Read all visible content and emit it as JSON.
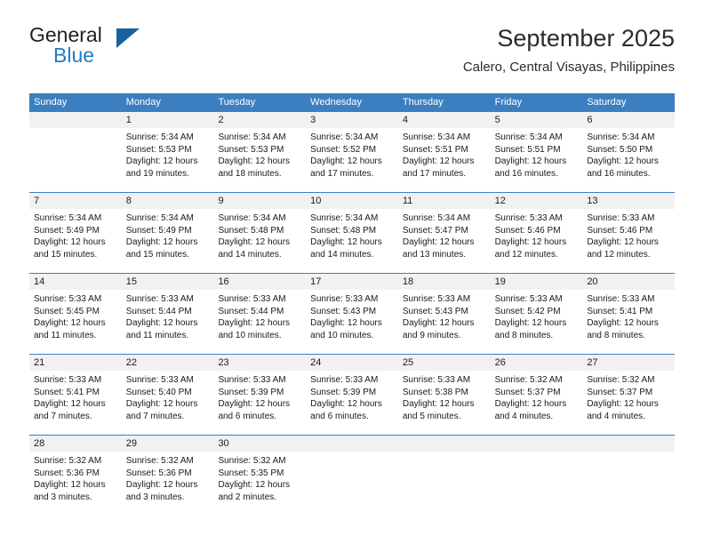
{
  "brand": {
    "name_part1": "General",
    "name_part2": "Blue",
    "triangle_icon": "triangle-icon",
    "color_dark": "#231f20",
    "color_blue": "#1f7dc4",
    "color_triangle": "#18619e"
  },
  "header": {
    "title": "September 2025",
    "subtitle": "Calero, Central Visayas, Philippines"
  },
  "theme": {
    "header_blue": "#3c7fc1",
    "day_band_gray": "#f1f1f1",
    "text": "#1a1a1a"
  },
  "weekdays": [
    "Sunday",
    "Monday",
    "Tuesday",
    "Wednesday",
    "Thursday",
    "Friday",
    "Saturday"
  ],
  "weeks": [
    [
      {
        "day": "",
        "sunrise": "",
        "sunset": "",
        "daylight_line1": "",
        "daylight_line2": "",
        "empty": true
      },
      {
        "day": "1",
        "sunrise": "Sunrise: 5:34 AM",
        "sunset": "Sunset: 5:53 PM",
        "daylight_line1": "Daylight: 12 hours",
        "daylight_line2": "and 19 minutes."
      },
      {
        "day": "2",
        "sunrise": "Sunrise: 5:34 AM",
        "sunset": "Sunset: 5:53 PM",
        "daylight_line1": "Daylight: 12 hours",
        "daylight_line2": "and 18 minutes."
      },
      {
        "day": "3",
        "sunrise": "Sunrise: 5:34 AM",
        "sunset": "Sunset: 5:52 PM",
        "daylight_line1": "Daylight: 12 hours",
        "daylight_line2": "and 17 minutes."
      },
      {
        "day": "4",
        "sunrise": "Sunrise: 5:34 AM",
        "sunset": "Sunset: 5:51 PM",
        "daylight_line1": "Daylight: 12 hours",
        "daylight_line2": "and 17 minutes."
      },
      {
        "day": "5",
        "sunrise": "Sunrise: 5:34 AM",
        "sunset": "Sunset: 5:51 PM",
        "daylight_line1": "Daylight: 12 hours",
        "daylight_line2": "and 16 minutes."
      },
      {
        "day": "6",
        "sunrise": "Sunrise: 5:34 AM",
        "sunset": "Sunset: 5:50 PM",
        "daylight_line1": "Daylight: 12 hours",
        "daylight_line2": "and 16 minutes."
      }
    ],
    [
      {
        "day": "7",
        "sunrise": "Sunrise: 5:34 AM",
        "sunset": "Sunset: 5:49 PM",
        "daylight_line1": "Daylight: 12 hours",
        "daylight_line2": "and 15 minutes."
      },
      {
        "day": "8",
        "sunrise": "Sunrise: 5:34 AM",
        "sunset": "Sunset: 5:49 PM",
        "daylight_line1": "Daylight: 12 hours",
        "daylight_line2": "and 15 minutes."
      },
      {
        "day": "9",
        "sunrise": "Sunrise: 5:34 AM",
        "sunset": "Sunset: 5:48 PM",
        "daylight_line1": "Daylight: 12 hours",
        "daylight_line2": "and 14 minutes."
      },
      {
        "day": "10",
        "sunrise": "Sunrise: 5:34 AM",
        "sunset": "Sunset: 5:48 PM",
        "daylight_line1": "Daylight: 12 hours",
        "daylight_line2": "and 14 minutes."
      },
      {
        "day": "11",
        "sunrise": "Sunrise: 5:34 AM",
        "sunset": "Sunset: 5:47 PM",
        "daylight_line1": "Daylight: 12 hours",
        "daylight_line2": "and 13 minutes."
      },
      {
        "day": "12",
        "sunrise": "Sunrise: 5:33 AM",
        "sunset": "Sunset: 5:46 PM",
        "daylight_line1": "Daylight: 12 hours",
        "daylight_line2": "and 12 minutes."
      },
      {
        "day": "13",
        "sunrise": "Sunrise: 5:33 AM",
        "sunset": "Sunset: 5:46 PM",
        "daylight_line1": "Daylight: 12 hours",
        "daylight_line2": "and 12 minutes."
      }
    ],
    [
      {
        "day": "14",
        "sunrise": "Sunrise: 5:33 AM",
        "sunset": "Sunset: 5:45 PM",
        "daylight_line1": "Daylight: 12 hours",
        "daylight_line2": "and 11 minutes."
      },
      {
        "day": "15",
        "sunrise": "Sunrise: 5:33 AM",
        "sunset": "Sunset: 5:44 PM",
        "daylight_line1": "Daylight: 12 hours",
        "daylight_line2": "and 11 minutes."
      },
      {
        "day": "16",
        "sunrise": "Sunrise: 5:33 AM",
        "sunset": "Sunset: 5:44 PM",
        "daylight_line1": "Daylight: 12 hours",
        "daylight_line2": "and 10 minutes."
      },
      {
        "day": "17",
        "sunrise": "Sunrise: 5:33 AM",
        "sunset": "Sunset: 5:43 PM",
        "daylight_line1": "Daylight: 12 hours",
        "daylight_line2": "and 10 minutes."
      },
      {
        "day": "18",
        "sunrise": "Sunrise: 5:33 AM",
        "sunset": "Sunset: 5:43 PM",
        "daylight_line1": "Daylight: 12 hours",
        "daylight_line2": "and 9 minutes."
      },
      {
        "day": "19",
        "sunrise": "Sunrise: 5:33 AM",
        "sunset": "Sunset: 5:42 PM",
        "daylight_line1": "Daylight: 12 hours",
        "daylight_line2": "and 8 minutes."
      },
      {
        "day": "20",
        "sunrise": "Sunrise: 5:33 AM",
        "sunset": "Sunset: 5:41 PM",
        "daylight_line1": "Daylight: 12 hours",
        "daylight_line2": "and 8 minutes."
      }
    ],
    [
      {
        "day": "21",
        "sunrise": "Sunrise: 5:33 AM",
        "sunset": "Sunset: 5:41 PM",
        "daylight_line1": "Daylight: 12 hours",
        "daylight_line2": "and 7 minutes."
      },
      {
        "day": "22",
        "sunrise": "Sunrise: 5:33 AM",
        "sunset": "Sunset: 5:40 PM",
        "daylight_line1": "Daylight: 12 hours",
        "daylight_line2": "and 7 minutes."
      },
      {
        "day": "23",
        "sunrise": "Sunrise: 5:33 AM",
        "sunset": "Sunset: 5:39 PM",
        "daylight_line1": "Daylight: 12 hours",
        "daylight_line2": "and 6 minutes."
      },
      {
        "day": "24",
        "sunrise": "Sunrise: 5:33 AM",
        "sunset": "Sunset: 5:39 PM",
        "daylight_line1": "Daylight: 12 hours",
        "daylight_line2": "and 6 minutes."
      },
      {
        "day": "25",
        "sunrise": "Sunrise: 5:33 AM",
        "sunset": "Sunset: 5:38 PM",
        "daylight_line1": "Daylight: 12 hours",
        "daylight_line2": "and 5 minutes."
      },
      {
        "day": "26",
        "sunrise": "Sunrise: 5:32 AM",
        "sunset": "Sunset: 5:37 PM",
        "daylight_line1": "Daylight: 12 hours",
        "daylight_line2": "and 4 minutes."
      },
      {
        "day": "27",
        "sunrise": "Sunrise: 5:32 AM",
        "sunset": "Sunset: 5:37 PM",
        "daylight_line1": "Daylight: 12 hours",
        "daylight_line2": "and 4 minutes."
      }
    ],
    [
      {
        "day": "28",
        "sunrise": "Sunrise: 5:32 AM",
        "sunset": "Sunset: 5:36 PM",
        "daylight_line1": "Daylight: 12 hours",
        "daylight_line2": "and 3 minutes."
      },
      {
        "day": "29",
        "sunrise": "Sunrise: 5:32 AM",
        "sunset": "Sunset: 5:36 PM",
        "daylight_line1": "Daylight: 12 hours",
        "daylight_line2": "and 3 minutes."
      },
      {
        "day": "30",
        "sunrise": "Sunrise: 5:32 AM",
        "sunset": "Sunset: 5:35 PM",
        "daylight_line1": "Daylight: 12 hours",
        "daylight_line2": "and 2 minutes."
      },
      {
        "day": "",
        "sunrise": "",
        "sunset": "",
        "daylight_line1": "",
        "daylight_line2": "",
        "empty": true
      },
      {
        "day": "",
        "sunrise": "",
        "sunset": "",
        "daylight_line1": "",
        "daylight_line2": "",
        "empty": true
      },
      {
        "day": "",
        "sunrise": "",
        "sunset": "",
        "daylight_line1": "",
        "daylight_line2": "",
        "empty": true
      },
      {
        "day": "",
        "sunrise": "",
        "sunset": "",
        "daylight_line1": "",
        "daylight_line2": "",
        "empty": true
      }
    ]
  ]
}
